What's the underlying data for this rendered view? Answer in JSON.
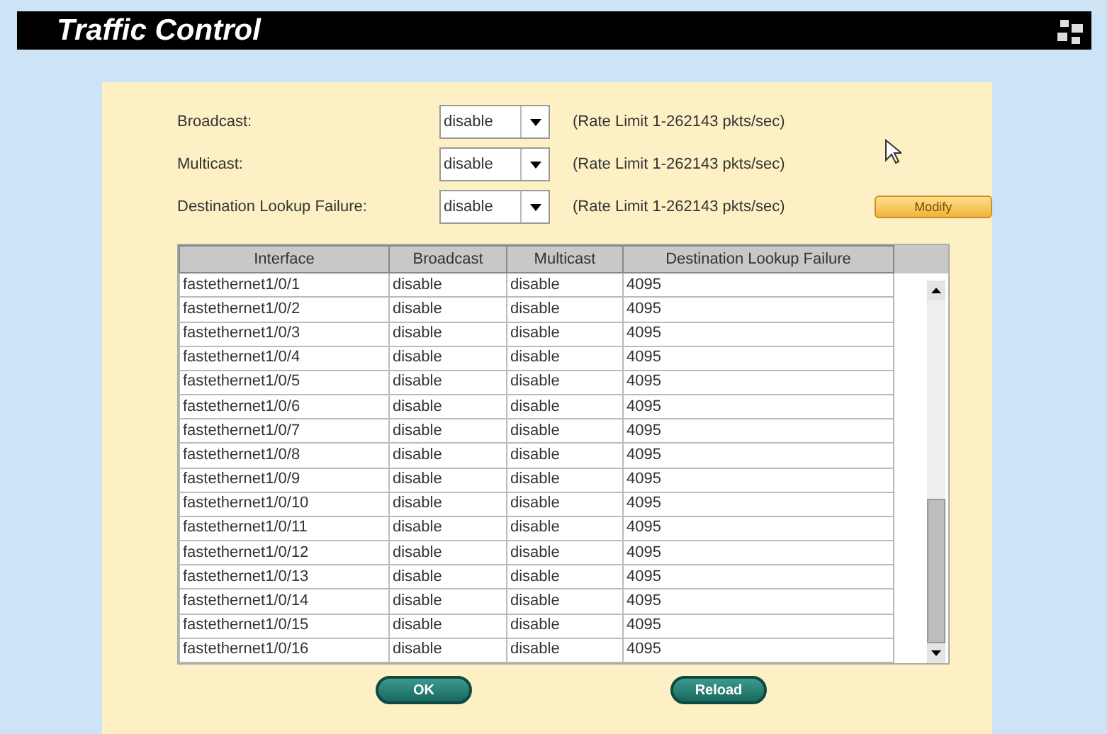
{
  "window": {
    "title": "Traffic Control"
  },
  "settings": [
    {
      "label": "Broadcast:",
      "value": "disable",
      "hint": "(Rate Limit 1-262143 pkts/sec)"
    },
    {
      "label": "Multicast:",
      "value": "disable",
      "hint": "(Rate Limit 1-262143 pkts/sec)"
    },
    {
      "label": "Destination Lookup Failure:",
      "value": "disable",
      "hint": "(Rate Limit 1-262143 pkts/sec)"
    }
  ],
  "modify_button": "Modify",
  "table": {
    "columns": [
      "Interface",
      "Broadcast",
      "Multicast",
      "Destination Lookup Failure"
    ],
    "rows": [
      [
        "fastethernet1/0/1",
        "disable",
        "disable",
        "4095"
      ],
      [
        "fastethernet1/0/2",
        "disable",
        "disable",
        "4095"
      ],
      [
        "fastethernet1/0/3",
        "disable",
        "disable",
        "4095"
      ],
      [
        "fastethernet1/0/4",
        "disable",
        "disable",
        "4095"
      ],
      [
        "fastethernet1/0/5",
        "disable",
        "disable",
        "4095"
      ],
      [
        "fastethernet1/0/6",
        "disable",
        "disable",
        "4095"
      ],
      [
        "fastethernet1/0/7",
        "disable",
        "disable",
        "4095"
      ],
      [
        "fastethernet1/0/8",
        "disable",
        "disable",
        "4095"
      ],
      [
        "fastethernet1/0/9",
        "disable",
        "disable",
        "4095"
      ],
      [
        "fastethernet1/0/10",
        "disable",
        "disable",
        "4095"
      ],
      [
        "fastethernet1/0/11",
        "disable",
        "disable",
        "4095"
      ],
      [
        "fastethernet1/0/12",
        "disable",
        "disable",
        "4095"
      ],
      [
        "fastethernet1/0/13",
        "disable",
        "disable",
        "4095"
      ],
      [
        "fastethernet1/0/14",
        "disable",
        "disable",
        "4095"
      ],
      [
        "fastethernet1/0/15",
        "disable",
        "disable",
        "4095"
      ],
      [
        "fastethernet1/0/16",
        "disable",
        "disable",
        "4095"
      ]
    ]
  },
  "buttons": [
    "OK",
    "Reload"
  ]
}
